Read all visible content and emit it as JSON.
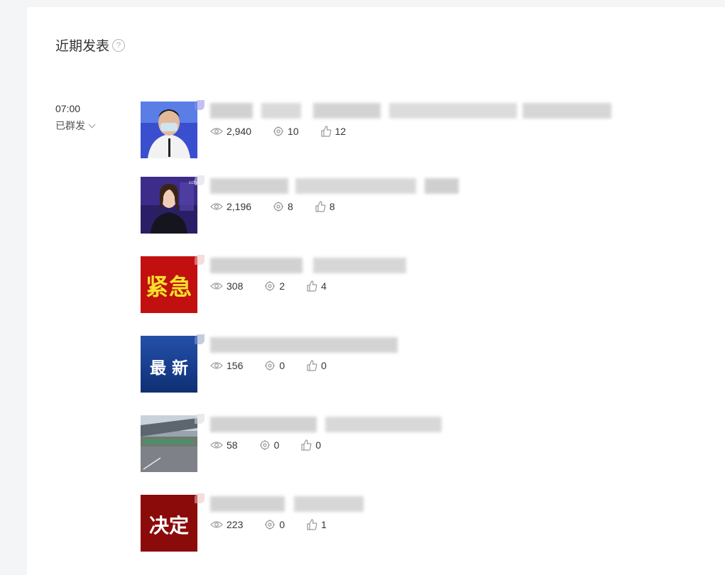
{
  "section": {
    "title": "近期发表"
  },
  "group": {
    "time": "07:00",
    "status": "已群发"
  },
  "articles": [
    {
      "thumb_text": "",
      "views": "2,940",
      "shares": "10",
      "likes": "12"
    },
    {
      "thumb_text": "",
      "views": "2,196",
      "shares": "8",
      "likes": "8"
    },
    {
      "thumb_text": "紧急",
      "views": "308",
      "shares": "2",
      "likes": "4"
    },
    {
      "thumb_text": "最 新",
      "views": "156",
      "shares": "0",
      "likes": "0"
    },
    {
      "thumb_text": "",
      "views": "58",
      "shares": "0",
      "likes": "0"
    },
    {
      "thumb_text": "决定",
      "views": "223",
      "shares": "0",
      "likes": "1"
    }
  ],
  "colors": {
    "thumb_urgent": "#c1100f",
    "thumb_latest": "#1a3f8f",
    "thumb_decision": "#8b0a0a",
    "urgent_text": "#f6e12a"
  }
}
